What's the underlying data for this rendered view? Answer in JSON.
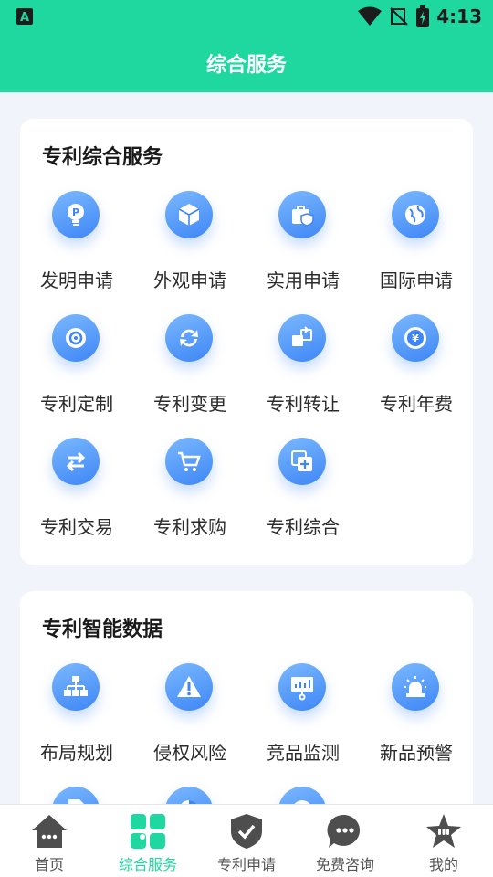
{
  "status_bar": {
    "time": "4:13"
  },
  "header": {
    "title": "综合服务"
  },
  "colors": {
    "brand": "#1fd8a0",
    "icon_blue": "#3e86f5",
    "active_nav": "#1fd8a0"
  },
  "sections": [
    {
      "title": "专利综合服务",
      "items": [
        {
          "label": "发明申请",
          "icon": "lightbulb-icon"
        },
        {
          "label": "外观申请",
          "icon": "cube-icon"
        },
        {
          "label": "实用申请",
          "icon": "briefcase-shield-icon"
        },
        {
          "label": "国际申请",
          "icon": "globe-icon"
        },
        {
          "label": "专利定制",
          "icon": "gear-icon"
        },
        {
          "label": "专利变更",
          "icon": "refresh-icon"
        },
        {
          "label": "专利转让",
          "icon": "transfer-icon"
        },
        {
          "label": "专利年费",
          "icon": "yen-coin-icon"
        },
        {
          "label": "专利交易",
          "icon": "exchange-arrows-icon"
        },
        {
          "label": "专利求购",
          "icon": "cart-icon"
        },
        {
          "label": "专利综合",
          "icon": "add-copy-icon"
        }
      ]
    },
    {
      "title": "专利智能数据",
      "items": [
        {
          "label": "布局规划",
          "icon": "org-chart-icon"
        },
        {
          "label": "侵权风险",
          "icon": "warning-icon"
        },
        {
          "label": "竞品监测",
          "icon": "presentation-icon"
        },
        {
          "label": "新品预警",
          "icon": "alarm-light-icon"
        },
        {
          "label": "",
          "icon": "document-icon"
        },
        {
          "label": "",
          "icon": "pie-chart-icon"
        },
        {
          "label": "",
          "icon": "info-icon"
        }
      ]
    }
  ],
  "bottom_nav": [
    {
      "label": "首页",
      "icon": "home-icon",
      "active": false
    },
    {
      "label": "综合服务",
      "icon": "grid-icon",
      "active": true
    },
    {
      "label": "专利申请",
      "icon": "shield-check-icon",
      "active": false
    },
    {
      "label": "免费咨询",
      "icon": "chat-bubble-icon",
      "active": false
    },
    {
      "label": "我的",
      "icon": "star-face-icon",
      "active": false
    }
  ]
}
